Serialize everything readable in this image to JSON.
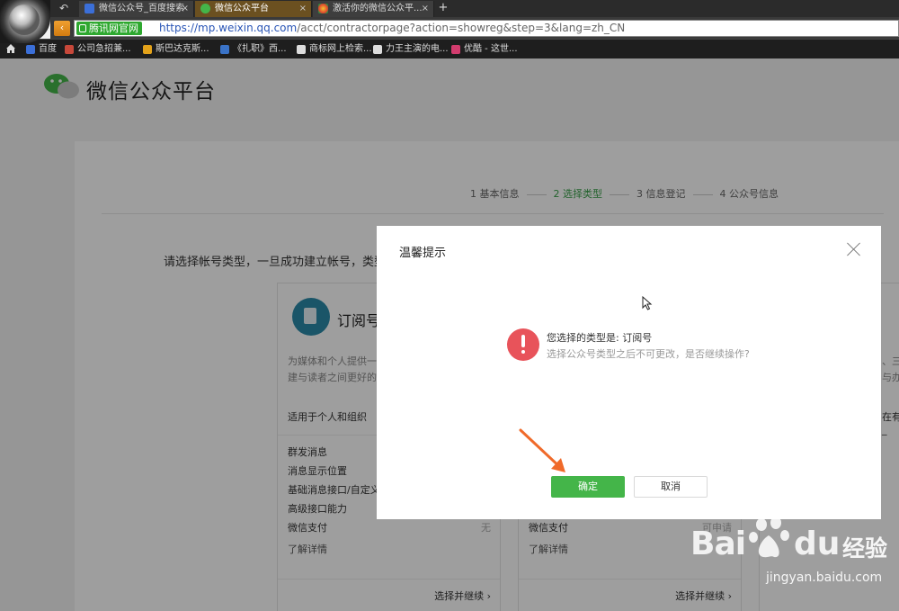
{
  "browser": {
    "tabs": [
      {
        "label": "微信公众号_百度搜索",
        "active": false
      },
      {
        "label": "微信公众平台",
        "active": true
      },
      {
        "label": "激活你的微信公众平...",
        "active": false
      }
    ],
    "close_glyph": "×",
    "new_tab_glyph": "+",
    "site_badge": "腾讯网官网",
    "url": {
      "host": "https://mp.weixin.qq.com",
      "path": "/acct/contractorpage?action=showreg&step=3&lang=zh_CN"
    },
    "bookmarks": [
      {
        "label": "百度",
        "icon": "baidu-icon",
        "color": "#3b6fd8"
      },
      {
        "label": "公司急招兼...",
        "icon": "recruit-icon",
        "color": "#c7483a"
      },
      {
        "label": "斯巴达克斯...",
        "icon": "v-icon",
        "color": "#e3a21a"
      },
      {
        "label": "《扎职》西...",
        "icon": "xl-icon",
        "color": "#3a73c7"
      },
      {
        "label": "商标网上检索...",
        "icon": "page-icon",
        "color": "#dddddd"
      },
      {
        "label": "力王主演的电...",
        "icon": "page-icon",
        "color": "#dddddd"
      },
      {
        "label": "优酷 - 这世...",
        "icon": "youku-icon",
        "color": "#d23c6e"
      }
    ]
  },
  "page": {
    "brand": "微信公众平台",
    "steps": [
      "1 基本信息",
      "2 选择类型",
      "3 信息登记",
      "4 公众号信息"
    ],
    "active_step": 1,
    "choose_text": "请选择帐号类型，一旦成功建立帐号，类型",
    "card_left": {
      "title": "订阅号",
      "desc_line1": "为媒体和个人提供一",
      "desc_line2": "建与读者之间更好的",
      "suit": "适用于个人和组织",
      "features": [
        {
          "label": "群发消息",
          "value": ""
        },
        {
          "label": "消息显示位置",
          "value": ""
        },
        {
          "label": "基础消息接口/自定义",
          "value": ""
        },
        {
          "label": "高级接口能力",
          "value": ""
        },
        {
          "label": "微信支付",
          "value": "无"
        }
      ],
      "learn_more": "了解详情",
      "select": "选择并继续"
    },
    "card_mid": {
      "features": [
        {
          "label": "微信支付",
          "value": "可申请"
        }
      ],
      "learn_more": "了解详情",
      "select": "选择并继续"
    },
    "card_right_fragments": {
      "line_a": "、三",
      "line_b": "与办",
      "suit_frag": "在有_"
    }
  },
  "dialog": {
    "title": "温馨提示",
    "message": "您选择的类型是: 订阅号",
    "submessage": "选择公众号类型之后不可更改，是否继续操作?",
    "confirm": "确定",
    "cancel": "取消"
  },
  "watermark": {
    "bai": "Bai",
    "du": "du",
    "jingyan": "经验",
    "url": "jingyan.baidu.com"
  },
  "colors": {
    "accent_green": "#44b549",
    "warning_red": "#e8535a",
    "arrow_orange": "#f06a2a"
  }
}
